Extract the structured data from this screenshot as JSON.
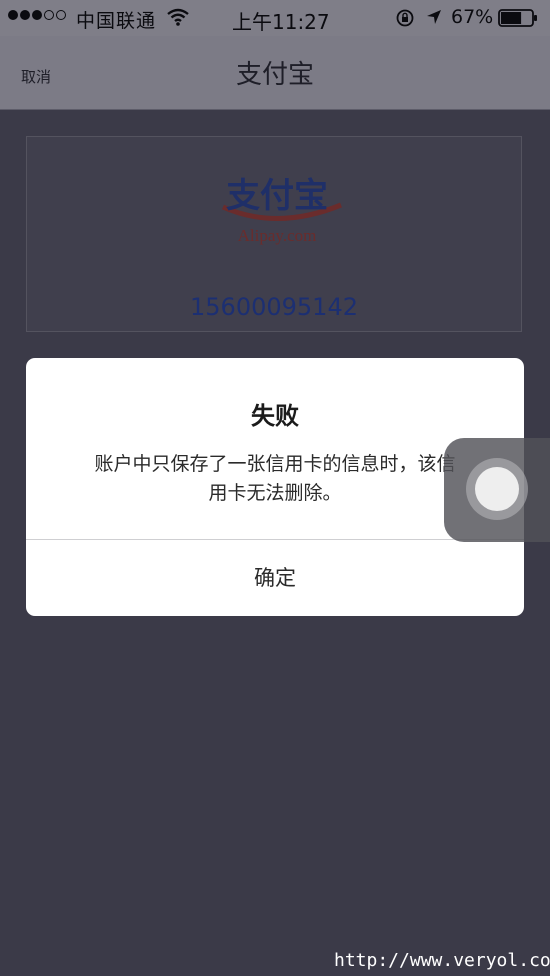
{
  "status_bar": {
    "carrier": "中国联通",
    "time": "上午11:27",
    "battery_text": "67%",
    "battery_level": 0.67,
    "signal_dots_filled": 3,
    "signal_dots_total": 5,
    "icons": [
      "wifi-icon",
      "orientation-lock-icon",
      "location-icon",
      "battery-icon"
    ]
  },
  "nav": {
    "cancel_label": "取消",
    "title": "支付宝"
  },
  "account": {
    "logo_text": "支付宝",
    "logo_domain": "Alipay.com",
    "account_number": "15600095142"
  },
  "alert": {
    "title": "失败",
    "message_line1": "账户中只保存了一张信用卡的信息时，该信",
    "message_line2": "用卡无法删除。",
    "button_label": "确定"
  },
  "watermark": "http://www.veryol.com",
  "colors": {
    "overlay_background": "#3b3a48",
    "account_number": "#1c2f72",
    "alert_background": "#ffffff"
  }
}
